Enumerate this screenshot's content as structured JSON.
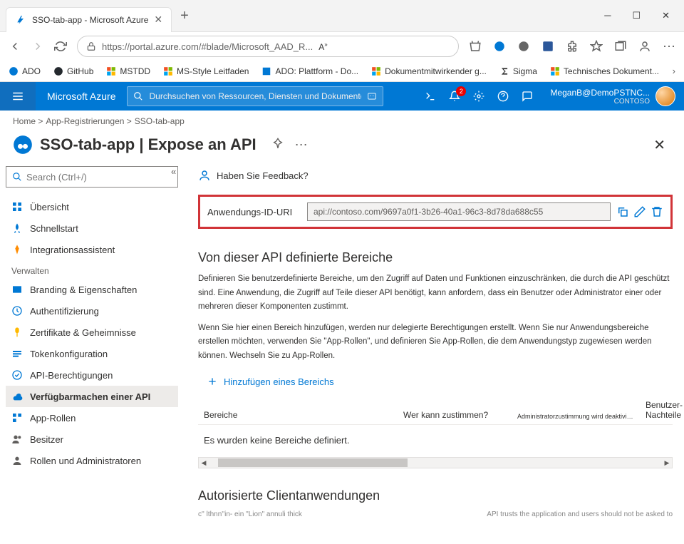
{
  "browser": {
    "tab_title": "SSO-tab-app - Microsoft Azure",
    "url": "https://portal.azure.com/#blade/Microsoft_AAD_R...",
    "url_suffix_icon_text": "A",
    "bookmarks": [
      {
        "label": "ADO"
      },
      {
        "label": "GitHub"
      },
      {
        "label": "MSTDD"
      },
      {
        "label": "MS-Style Leitfaden"
      },
      {
        "label": "ADO: Plattform - Do..."
      },
      {
        "label": "Dokumentmitwirkender g..."
      },
      {
        "label": "Sigma"
      },
      {
        "label": "Technisches Dokument..."
      }
    ]
  },
  "portal": {
    "brand": "Microsoft Azure",
    "search_placeholder": "Durchsuchen von Ressourcen, Diensten und Dokumenten (G+/)",
    "notification_count": "2",
    "user_name": "MeganB@DemoPSTNC...",
    "tenant": "CONTOSO"
  },
  "breadcrumb": {
    "items": [
      "Home >",
      "App-Registrierungen >",
      "SSO-tab-app"
    ]
  },
  "header": {
    "title": "SSO-tab-app | Expose an API"
  },
  "sidebar": {
    "search_placeholder": "Search (Ctrl+/)",
    "items": [
      {
        "label": "Übersicht"
      },
      {
        "label": "Schnellstart"
      },
      {
        "label": "Integrationsassistent"
      }
    ],
    "section": "Verwalten",
    "manage": [
      {
        "label": "Branding &amp; Eigenschaften"
      },
      {
        "label": "Authentifizierung"
      },
      {
        "label": "Zertifikate &amp; Geheimnisse"
      },
      {
        "label": "Tokenkonfiguration"
      },
      {
        "label": "API-Berechtigungen"
      },
      {
        "label": "Verfügbarmachen einer API"
      },
      {
        "label": "App-Rollen"
      },
      {
        "label": "Besitzer"
      },
      {
        "label": "Rollen und Administratoren"
      }
    ]
  },
  "content": {
    "feedback": "Haben Sie Feedback?",
    "uri_label": "Anwendungs-ID-URI",
    "uri_value": "api://contoso.com/9697a0f1-3b26-40a1-96c3-8d78da688c55",
    "scopes_heading": "Von dieser API definierte Bereiche",
    "scopes_p1": "Definieren Sie benutzerdefinierte Bereiche, um den Zugriff auf Daten und Funktionen einzuschränken, die durch die API geschützt sind. Eine Anwendung, die Zugriff auf Teile dieser API benötigt, kann anfordern, dass ein Benutzer oder Administrator einer oder mehreren dieser Komponenten zustimmt.",
    "scopes_p2": "Wenn Sie hier einen Bereich hinzufügen, werden nur delegierte Berechtigungen erstellt. Wenn Sie nur Anwendungsbereiche erstellen möchten, verwenden Sie \"App-Rollen\", und definieren Sie App-Rollen, die dem Anwendungstyp zugewiesen werden können. Wechseln Sie zu App-Rollen.",
    "add_scope": "Hinzufügen eines Bereichs",
    "table": {
      "col1": "Bereiche",
      "col2": "Wer kann zustimmen?",
      "col3": "Administratorzustimmung wird deaktiviert...",
      "col4": "Benutzer-Nachteile",
      "empty": "Es wurden keine Bereiche definiert."
    },
    "clients_heading": "Autorisierte Clientanwendungen",
    "clients_truncated_left": "c'' lthnn''in- ein \"Lion\" annuli thick",
    "clients_truncated_right": "API trusts the application and users should not be asked to"
  }
}
